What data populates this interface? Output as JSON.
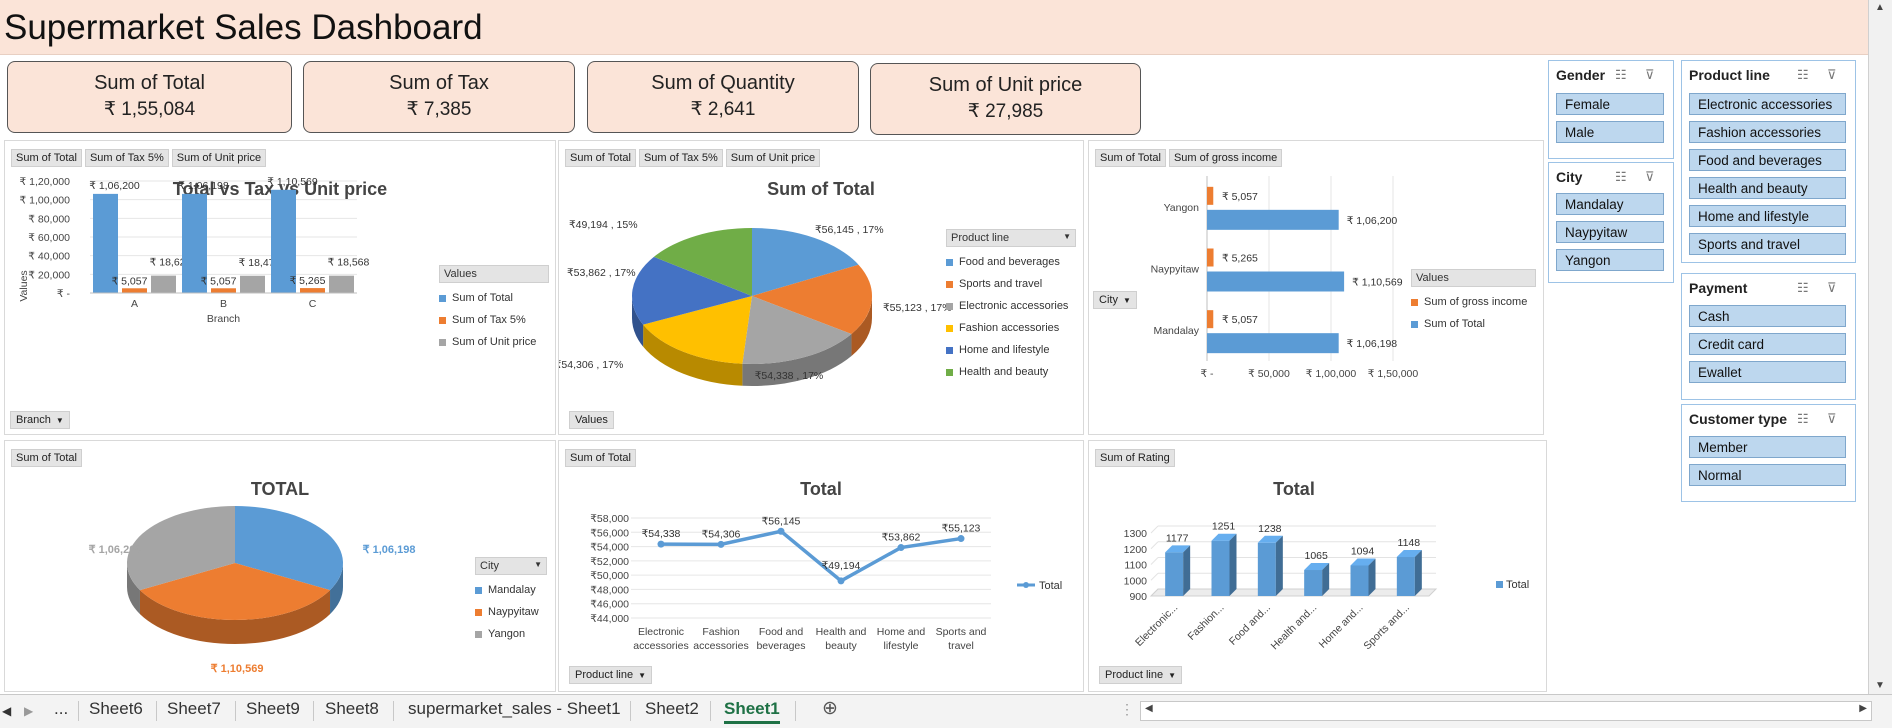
{
  "dashboard": {
    "title": "Supermarket Sales Dashboard"
  },
  "kpis": [
    {
      "label": "Sum of Total",
      "value": "₹ 1,55,084"
    },
    {
      "label": "Sum of Tax",
      "value": "₹ 7,385"
    },
    {
      "label": "Sum of Quantity",
      "value": "₹ 2,641"
    },
    {
      "label": "Sum of Unit price",
      "value": "₹ 27,985"
    }
  ],
  "bar_panel": {
    "fields": [
      "Sum of Total",
      "Sum of Tax 5%",
      "Sum of Unit price"
    ],
    "title": "Total vs Tax vs Unit price",
    "legend_title": "Values",
    "axis_dropdown": "Branch"
  },
  "pie_panel": {
    "fields": [
      "Sum of Total",
      "Sum of Tax 5%",
      "Sum of Unit price"
    ],
    "title": "Sum of Total",
    "legend_title": "Product line",
    "values_button": "Values"
  },
  "hbar_panel": {
    "fields": [
      "Sum of Total",
      "Sum of gross income"
    ],
    "legend_title": "Values",
    "axis_dropdown": "City"
  },
  "city_pie_panel": {
    "fields": [
      "Sum of Total"
    ],
    "title": "TOTAL",
    "legend_title": "City"
  },
  "line_panel": {
    "fields": [
      "Sum of Total"
    ],
    "title": "Total",
    "axis_dropdown": "Product line"
  },
  "column3d_panel": {
    "fields": [
      "Sum of Rating"
    ],
    "title": "Total",
    "axis_dropdown": "Product line"
  },
  "chart_data": [
    {
      "type": "bar",
      "title": "Total vs Tax vs Unit price",
      "xlabel": "Branch",
      "ylabel": "Values",
      "categories": [
        "A",
        "B",
        "C"
      ],
      "series": [
        {
          "name": "Sum of Total",
          "values": [
            106200,
            106198,
            110569
          ],
          "labels": [
            "₹ 1,06,200",
            "₹ 1,06,198",
            "₹ 1,10,569"
          ],
          "color": "#5b9bd5"
        },
        {
          "name": "Sum of Tax 5%",
          "values": [
            5057,
            5057,
            5265
          ],
          "labels": [
            "₹ 5,057",
            "₹ 5,057",
            "₹ 5,265"
          ],
          "color": "#ed7d31"
        },
        {
          "name": "Sum of Unit price",
          "values": [
            18625,
            18479,
            18568
          ],
          "labels": [
            "₹ 18,625",
            "₹ 18,479",
            "₹ 18,568"
          ],
          "color": "#a5a5a5"
        }
      ],
      "ylim": [
        0,
        120000
      ],
      "yticks": [
        0,
        20000,
        40000,
        60000,
        80000,
        100000,
        120000
      ],
      "ytick_labels": [
        "₹ -",
        "₹ 20,000",
        "₹ 40,000",
        "₹ 60,000",
        "₹ 80,000",
        "₹ 1,00,000",
        "₹ 1,20,000"
      ],
      "legend": "right"
    },
    {
      "type": "pie",
      "title": "Sum of Total",
      "slices": [
        {
          "name": "Food and beverages",
          "value": 56145,
          "label": "₹56,145 , 17%",
          "color": "#5b9bd5"
        },
        {
          "name": "Sports and travel",
          "value": 55123,
          "label": "₹55,123 , 17%",
          "color": "#ed7d31"
        },
        {
          "name": "Electronic accessories",
          "value": 54338,
          "label": "₹54,338 , 17%",
          "color": "#a5a5a5"
        },
        {
          "name": "Fashion accessories",
          "value": 54306,
          "label": "₹54,306 , 17%",
          "color": "#ffc000"
        },
        {
          "name": "Home and lifestyle",
          "value": 53862,
          "label": "₹53,862 , 17%",
          "color": "#4472c4"
        },
        {
          "name": "Health and beauty",
          "value": 49194,
          "label": "₹49,194 , 15%",
          "color": "#70ad47"
        }
      ],
      "legend": "right"
    },
    {
      "type": "bar",
      "orientation": "horizontal",
      "categories": [
        "Yangon",
        "Naypyitaw",
        "Mandalay"
      ],
      "series": [
        {
          "name": "Sum of gross income",
          "values": [
            5057,
            5265,
            5057
          ],
          "labels": [
            "₹ 5,057",
            "₹ 5,265",
            "₹ 5,057"
          ],
          "color": "#ed7d31"
        },
        {
          "name": "Sum of Total",
          "values": [
            106200,
            110569,
            106198
          ],
          "labels": [
            "₹ 1,06,200",
            "₹ 1,10,569",
            "₹ 1,06,198"
          ],
          "color": "#5b9bd5"
        }
      ],
      "xlim": [
        0,
        150000
      ],
      "xticks": [
        0,
        50000,
        100000,
        150000
      ],
      "xtick_labels": [
        "₹ -",
        "₹ 50,000",
        "₹ 1,00,000",
        "₹ 1,50,000"
      ],
      "legend": "right"
    },
    {
      "type": "pie",
      "title": "TOTAL",
      "slices": [
        {
          "name": "Mandalay",
          "value": 106198,
          "label": "₹ 1,06,198",
          "color": "#5b9bd5"
        },
        {
          "name": "Naypyitaw",
          "value": 110569,
          "label": "₹ 1,10,569",
          "color": "#ed7d31"
        },
        {
          "name": "Yangon",
          "value": 106200,
          "label": "₹ 1,06,200",
          "color": "#a5a5a5"
        }
      ],
      "legend": "right"
    },
    {
      "type": "line",
      "title": "Total",
      "categories": [
        "Electronic accessories",
        "Fashion accessories",
        "Food and beverages",
        "Health and beauty",
        "Home and lifestyle",
        "Sports and travel"
      ],
      "series": [
        {
          "name": "Total",
          "values": [
            54338,
            54306,
            56145,
            49194,
            53862,
            55123
          ],
          "labels": [
            "₹54,338",
            "₹54,306",
            "₹56,145",
            "₹49,194",
            "₹53,862",
            "₹55,123"
          ],
          "color": "#5b9bd5"
        }
      ],
      "ylim": [
        44000,
        58000
      ],
      "yticks": [
        44000,
        46000,
        48000,
        50000,
        52000,
        54000,
        56000,
        58000
      ],
      "ytick_labels": [
        "₹44,000",
        "₹46,000",
        "₹48,000",
        "₹50,000",
        "₹52,000",
        "₹54,000",
        "₹56,000",
        "₹58,000"
      ],
      "legend": "right"
    },
    {
      "type": "bar",
      "title": "Total",
      "categories": [
        "Electronic...",
        "Fashion...",
        "Food and...",
        "Health and...",
        "Home and...",
        "Sports and..."
      ],
      "series": [
        {
          "name": "Total",
          "values": [
            1177,
            1251,
            1238,
            1065,
            1094,
            1148
          ],
          "color": "#5b9bd5"
        }
      ],
      "ylim": [
        900,
        1300
      ],
      "yticks": [
        900,
        1000,
        1100,
        1200,
        1300
      ],
      "legend": "right"
    }
  ],
  "slicers": {
    "gender": {
      "title": "Gender",
      "items": [
        "Female",
        "Male"
      ]
    },
    "city": {
      "title": "City",
      "items": [
        "Mandalay",
        "Naypyitaw",
        "Yangon"
      ]
    },
    "product_line": {
      "title": "Product line",
      "items": [
        "Electronic accessories",
        "Fashion accessories",
        "Food and beverages",
        "Health and beauty",
        "Home and lifestyle",
        "Sports and travel"
      ]
    },
    "payment": {
      "title": "Payment",
      "items": [
        "Cash",
        "Credit card",
        "Ewallet"
      ]
    },
    "customer_type": {
      "title": "Customer type",
      "items": [
        "Member",
        "Normal"
      ]
    }
  },
  "sheet_tabs": {
    "ellipsis": "...",
    "tabs": [
      "Sheet6",
      "Sheet7",
      "Sheet9",
      "Sheet8",
      "supermarket_sales - Sheet1",
      "Sheet2",
      "Sheet1"
    ],
    "active": "Sheet1",
    "add": "⊕"
  }
}
